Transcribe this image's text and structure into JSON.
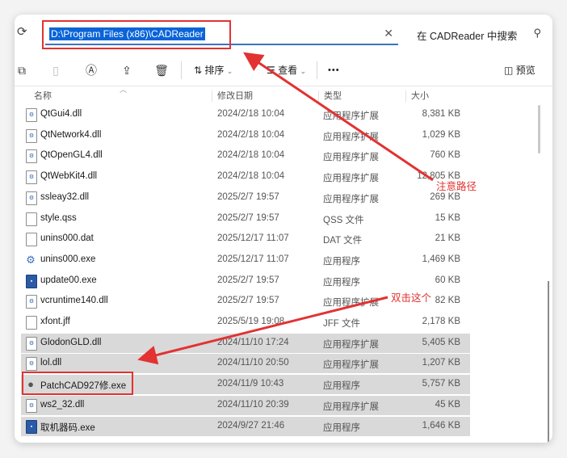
{
  "address_bar": {
    "path": "D:\\Program Files (x86)\\CADReader",
    "clear_glyph": "✕"
  },
  "search": {
    "placeholder": "在 CADReader 中搜索"
  },
  "toolbar": {
    "sort_label": "排序",
    "view_label": "查看",
    "more_label": "•••",
    "preview_label": "预览"
  },
  "columns": {
    "name": "名称",
    "date": "修改日期",
    "type": "类型",
    "size": "大小"
  },
  "files": [
    {
      "name": "QtGui4.dll",
      "date": "2024/2/18 10:04",
      "type": "应用程序扩展",
      "size": "8,381 KB",
      "icon": "dll",
      "selected": false
    },
    {
      "name": "QtNetwork4.dll",
      "date": "2024/2/18 10:04",
      "type": "应用程序扩展",
      "size": "1,029 KB",
      "icon": "dll",
      "selected": false
    },
    {
      "name": "QtOpenGL4.dll",
      "date": "2024/2/18 10:04",
      "type": "应用程序扩展",
      "size": "760 KB",
      "icon": "dll",
      "selected": false
    },
    {
      "name": "QtWebKit4.dll",
      "date": "2024/2/18 10:04",
      "type": "应用程序扩展",
      "size": "12,805 KB",
      "icon": "dll",
      "selected": false
    },
    {
      "name": "ssleay32.dll",
      "date": "2025/2/7 19:57",
      "type": "应用程序扩展",
      "size": "269 KB",
      "icon": "dll",
      "selected": false
    },
    {
      "name": "style.qss",
      "date": "2025/2/7 19:57",
      "type": "QSS 文件",
      "size": "15 KB",
      "icon": "file",
      "selected": false
    },
    {
      "name": "unins000.dat",
      "date": "2025/12/17 11:07",
      "type": "DAT 文件",
      "size": "21 KB",
      "icon": "file",
      "selected": false
    },
    {
      "name": "unins000.exe",
      "date": "2025/12/17 11:07",
      "type": "应用程序",
      "size": "1,469 KB",
      "icon": "gear",
      "selected": false
    },
    {
      "name": "update00.exe",
      "date": "2025/2/7 19:57",
      "type": "应用程序",
      "size": "60 KB",
      "icon": "exe",
      "selected": false
    },
    {
      "name": "vcruntime140.dll",
      "date": "2025/2/7 19:57",
      "type": "应用程序扩展",
      "size": "82 KB",
      "icon": "dll",
      "selected": false
    },
    {
      "name": "xfont.jff",
      "date": "2025/5/19 19:08",
      "type": "JFF 文件",
      "size": "2,178 KB",
      "icon": "file",
      "selected": false
    },
    {
      "name": "GlodonGLD.dll",
      "date": "2024/11/10 17:24",
      "type": "应用程序扩展",
      "size": "5,405 KB",
      "icon": "dll",
      "selected": true
    },
    {
      "name": "lol.dll",
      "date": "2024/11/10 20:50",
      "type": "应用程序扩展",
      "size": "1,207 KB",
      "icon": "dll",
      "selected": true
    },
    {
      "name": "PatchCAD927修.exe",
      "date": "2024/11/9 10:43",
      "type": "应用程序",
      "size": "5,757 KB",
      "icon": "ball",
      "selected": true
    },
    {
      "name": "ws2_32.dll",
      "date": "2024/11/10 20:39",
      "type": "应用程序扩展",
      "size": "45 KB",
      "icon": "dll",
      "selected": true
    },
    {
      "name": "取机器码.exe",
      "date": "2024/9/27 21:46",
      "type": "应用程序",
      "size": "1,646 KB",
      "icon": "exe",
      "selected": true
    }
  ],
  "annotations": {
    "path_note": "注意路径",
    "dblclick_note": "双击这个",
    "color": "#e23232"
  },
  "icons": [
    "refresh-icon",
    "search-icon",
    "copy-icon",
    "paste-icon",
    "rename-icon",
    "share-icon",
    "delete-icon",
    "sort-icon",
    "view-icon",
    "preview-pane-icon"
  ]
}
